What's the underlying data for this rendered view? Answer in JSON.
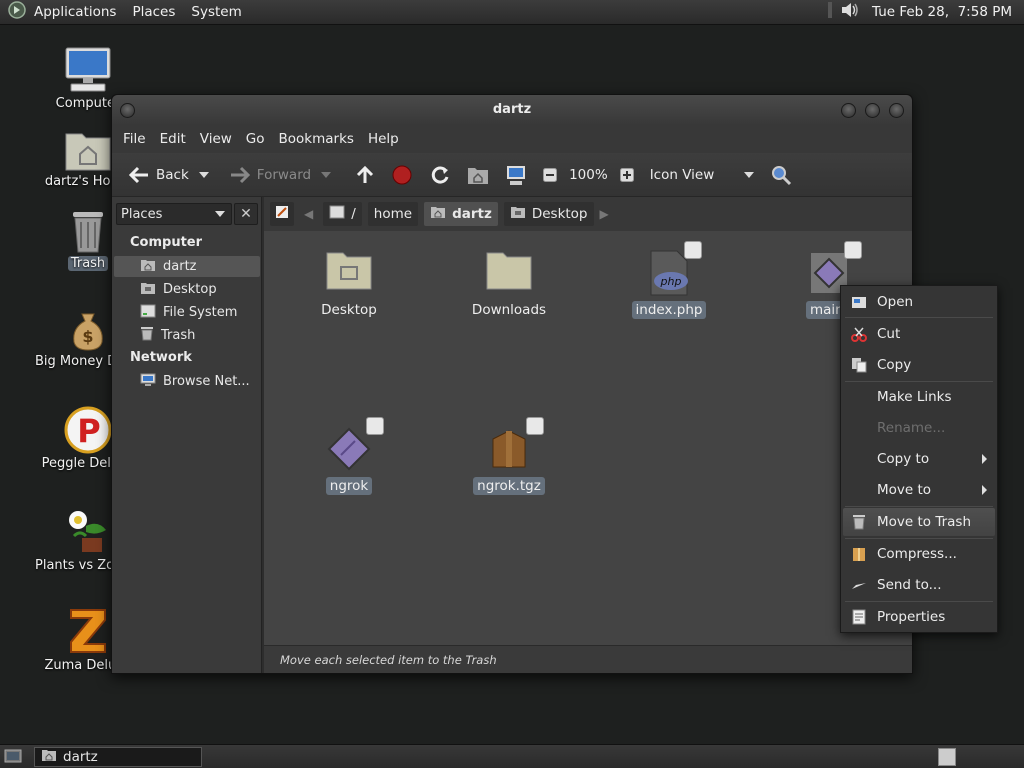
{
  "top_panel": {
    "menus": [
      "Applications",
      "Places",
      "System"
    ],
    "clock": "Tue Feb 28,  7:58 PM",
    "volume_icon": "speaker-icon"
  },
  "desktop_icons": [
    {
      "label": "Computer",
      "icon": "computer-icon"
    },
    {
      "label": "dartz's Home",
      "icon": "home-folder-icon"
    },
    {
      "label": "Trash",
      "icon": "trash-icon"
    },
    {
      "label": "Big Money Deluxe",
      "icon": "money-bag-icon"
    },
    {
      "label": "Peggle Deluxe",
      "icon": "peggle-icon"
    },
    {
      "label": "Plants vs Zombies",
      "icon": "plants-icon"
    },
    {
      "label": "Zuma Deluxe",
      "icon": "zuma-icon"
    }
  ],
  "window": {
    "title": "dartz",
    "menus": [
      "File",
      "Edit",
      "View",
      "Go",
      "Bookmarks",
      "Help"
    ],
    "toolbar": {
      "back": "Back",
      "forward": "Forward",
      "zoom": "100%",
      "view_mode": "Icon View"
    },
    "sidebar": {
      "combo": "Places",
      "close": "✕",
      "computer_heading": "Computer",
      "computer_items": [
        "dartz",
        "Desktop",
        "File System",
        "Trash"
      ],
      "network_heading": "Network",
      "network_items": [
        "Browse Net..."
      ]
    },
    "location": {
      "separator": "/",
      "crumbs": [
        "home",
        "dartz",
        "Desktop"
      ]
    },
    "files": [
      {
        "name": "Desktop",
        "type": "folder-desktop"
      },
      {
        "name": "Downloads",
        "type": "folder"
      },
      {
        "name": "index.php",
        "type": "php"
      },
      {
        "name": "main.",
        "type": "binary"
      },
      {
        "name": "ngrok",
        "type": "binary"
      },
      {
        "name": "ngrok.tgz",
        "type": "archive"
      }
    ],
    "status": "Move each selected item to the Trash"
  },
  "context_menu": {
    "items": [
      "Open",
      "Cut",
      "Copy",
      "Make Links",
      "Rename...",
      "Copy to",
      "Move to",
      "Move to Trash",
      "Compress...",
      "Send to...",
      "Properties"
    ],
    "disabled": "Rename...",
    "highlighted": "Move to Trash"
  },
  "bottom_panel": {
    "task": "dartz"
  },
  "colors": {
    "desktop_bg": "#1e201f",
    "panel": "#333333",
    "file_area": "#444444",
    "selection": "#65707c"
  }
}
